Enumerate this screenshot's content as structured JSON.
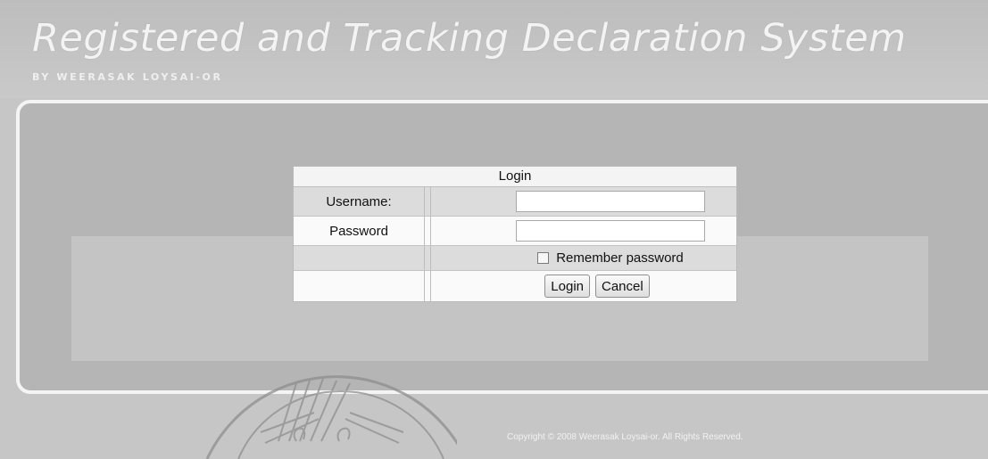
{
  "header": {
    "title": "Registered and Tracking Declaration System",
    "subtitle": "BY WEERASAK LOYSAI-OR"
  },
  "login": {
    "title": "Login",
    "username_label": "Username:",
    "username_value": "",
    "password_label": "Password",
    "password_value": "",
    "remember_label": "Remember password",
    "remember_checked": false,
    "login_button": "Login",
    "cancel_button": "Cancel"
  },
  "footer": {
    "copyright": "Copyright © 2008 Weerasak Loysai-or. All Rights Reserved."
  },
  "colors": {
    "background": "#c6c6c6",
    "panel": "#b5b5b5",
    "panel_border": "#f4f4f4",
    "title_text": "#f3f3f3"
  }
}
